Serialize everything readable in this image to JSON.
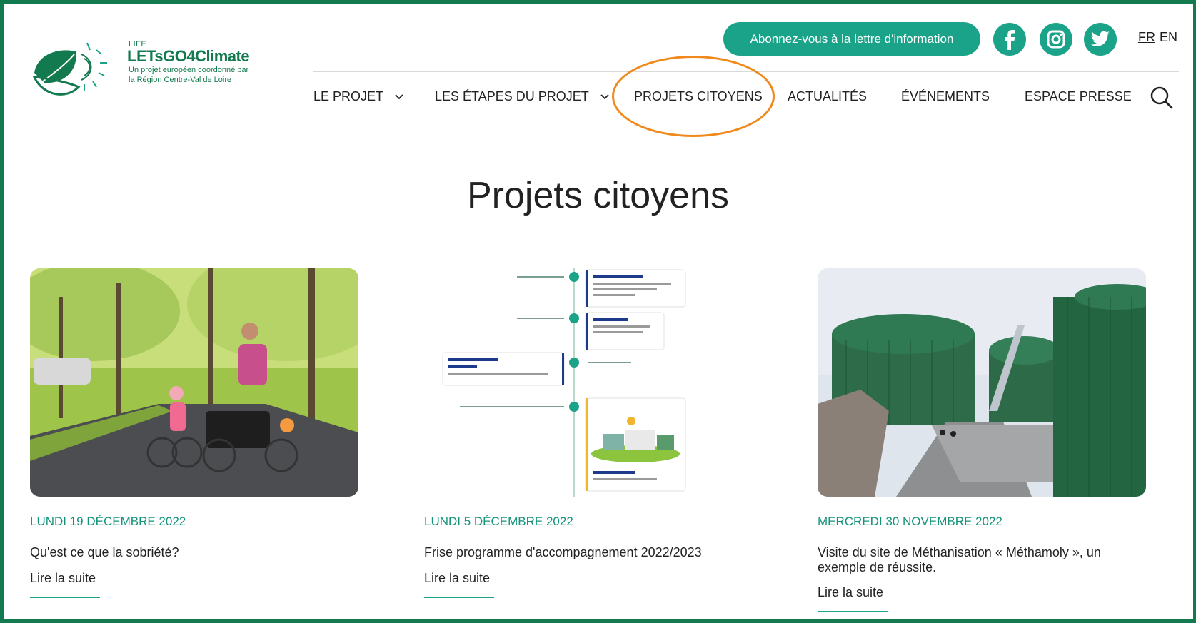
{
  "logo": {
    "life": "LIFE",
    "brand": "LETsGO4Climate",
    "subtitle_line1": "Un projet européen coordonné par",
    "subtitle_line2": "la Région Centre-Val de Loire"
  },
  "header": {
    "newsletter_label": "Abonnez-vous à la lettre d'information",
    "social": [
      "facebook-icon",
      "instagram-icon",
      "twitter-icon"
    ],
    "languages": [
      {
        "label": "FR",
        "active": true
      },
      {
        "label": "EN",
        "active": false
      }
    ]
  },
  "nav": {
    "items": [
      {
        "label": "LE PROJET",
        "has_dropdown": true
      },
      {
        "label": "LES ÉTAPES DU PROJET",
        "has_dropdown": true
      },
      {
        "label": "PROJETS CITOYENS",
        "has_dropdown": false,
        "highlighted": true
      },
      {
        "label": "ACTUALITÉS",
        "has_dropdown": false
      },
      {
        "label": "ÉVÉNEMENTS",
        "has_dropdown": false
      },
      {
        "label": "ESPACE PRESSE",
        "has_dropdown": false
      }
    ],
    "search_icon": "search-icon"
  },
  "page": {
    "title": "Projets citoyens"
  },
  "cards": [
    {
      "date": "LUNDI 19 DÉCEMBRE 2022",
      "title": "Qu'est ce que la sobriété?",
      "read_more": "Lire la suite"
    },
    {
      "date": "LUNDI 5 DÉCEMBRE 2022",
      "title": "Frise programme d'accompagnement 2022/2023",
      "read_more": "Lire la suite"
    },
    {
      "date": "MERCREDI 30 NOVEMBRE 2022",
      "title": "Visite du site de Méthanisation « Méthamoly », un exemple de réussite.",
      "read_more": "Lire la suite"
    }
  ],
  "colors": {
    "brand_green": "#127a4e",
    "accent_teal": "#1aa389",
    "date_teal": "#14937a",
    "highlight_orange": "#f08a1c"
  }
}
